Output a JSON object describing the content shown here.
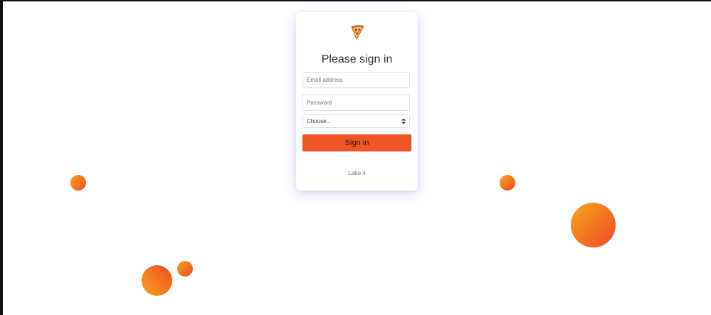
{
  "login": {
    "logo_icon": "pizza-slice-icon",
    "title": "Please sign in",
    "email_placeholder": "Email address",
    "password_placeholder": "Password",
    "select_value": "Choose...",
    "submit_label": "Sign in",
    "footer": "Labo 4"
  },
  "colors": {
    "accent": "#ef5424",
    "bubble_light": "#f8a51b",
    "bubble_dark": "#ef4a25"
  }
}
